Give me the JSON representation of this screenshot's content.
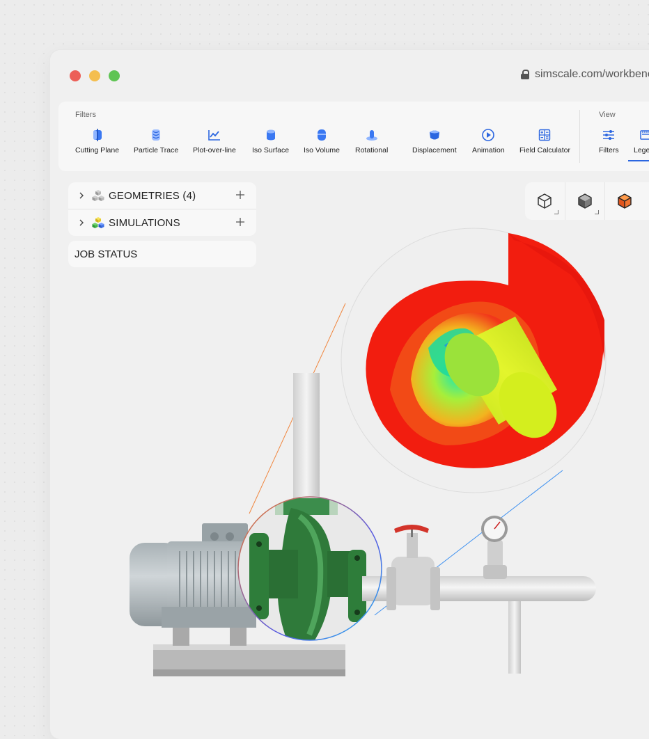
{
  "window": {
    "url": "simscale.com/workbench"
  },
  "toolbar": {
    "filters_label": "Filters",
    "view_label": "View",
    "tools": [
      {
        "label": "Cutting Plane",
        "icon": "cutting-plane-icon"
      },
      {
        "label": "Particle Trace",
        "icon": "particle-trace-icon"
      },
      {
        "label": "Plot-over-line",
        "icon": "plot-over-line-icon"
      },
      {
        "label": "Iso Surface",
        "icon": "iso-surface-icon"
      },
      {
        "label": "Iso Volume",
        "icon": "iso-volume-icon"
      },
      {
        "label": "Rotational",
        "icon": "rotational-icon"
      },
      {
        "label": "Displacement",
        "icon": "displacement-icon"
      },
      {
        "label": "Animation",
        "icon": "animation-icon"
      },
      {
        "label": "Field Calculator",
        "icon": "field-calculator-icon"
      }
    ],
    "view_tools": [
      {
        "label": "Filters",
        "icon": "sliders-icon"
      },
      {
        "label": "Legend",
        "icon": "legend-icon"
      }
    ]
  },
  "tree": {
    "geometries": "GEOMETRIES (4)",
    "simulations": "SIMULATIONS"
  },
  "job_status": "JOB STATUS",
  "colors": {
    "accent": "#2b66e0",
    "pump_green": "#2f7a3a",
    "result_red": "#f21d0f",
    "result_yellow": "#d7f01e"
  }
}
